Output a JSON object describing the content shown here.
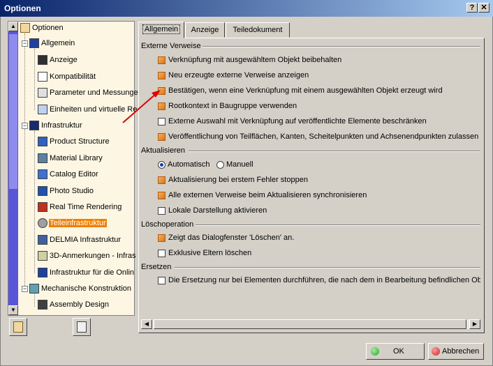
{
  "window": {
    "title": "Optionen",
    "help_label": "?",
    "close_label": "✕"
  },
  "tree": [
    {
      "label": "Optionen",
      "icon": "options-root-icon"
    },
    {
      "label": "Allgemein",
      "icon": "general-icon"
    },
    {
      "label": "Anzeige",
      "icon": "display-icon"
    },
    {
      "label": "Kompatibilität",
      "icon": "compatibility-icon"
    },
    {
      "label": "Parameter und Messungen",
      "icon": "parameters-icon"
    },
    {
      "label": "Einheiten und virtuelle Re",
      "icon": "units-icon"
    },
    {
      "label": "Infrastruktur",
      "icon": "infrastructure-icon"
    },
    {
      "label": "Product Structure",
      "icon": "product-structure-icon"
    },
    {
      "label": "Material Library",
      "icon": "material-library-icon"
    },
    {
      "label": "Catalog Editor",
      "icon": "catalog-editor-icon"
    },
    {
      "label": "Photo Studio",
      "icon": "photo-studio-icon"
    },
    {
      "label": "Real Time Rendering",
      "icon": "real-time-rendering-icon"
    },
    {
      "label": "Teileinfrastruktur",
      "icon": "part-infrastructure-icon"
    },
    {
      "label": "DELMIA Infrastruktur",
      "icon": "delmia-icon"
    },
    {
      "label": "3D-Anmerkungen - Infras",
      "icon": "annotations-icon"
    },
    {
      "label": "Infrastruktur für die Onlin",
      "icon": "online-infrastructure-icon"
    },
    {
      "label": "Mechanische Konstruktion",
      "icon": "mechanical-design-icon"
    },
    {
      "label": "Assembly Design",
      "icon": "assembly-design-icon"
    }
  ],
  "tabs": [
    {
      "label": "Allgemein"
    },
    {
      "label": "Anzeige"
    },
    {
      "label": "Teiledokument"
    }
  ],
  "sections": {
    "externe_verweise": {
      "title": "Externe Verweise",
      "options": [
        {
          "label": "Verknüpfung mit ausgewähltem Objekt beibehalten",
          "checked": true
        },
        {
          "label": "Neu erzeugte externe Verweise anzeigen",
          "checked": true
        },
        {
          "label": "Bestätigen, wenn eine Verknüpfung mit einem ausgewählten Objekt erzeugt wird",
          "checked": true
        },
        {
          "label": "Rootkontext in Baugruppe verwenden",
          "checked": true
        },
        {
          "label": "Externe Auswahl mit Verknüpfung auf veröffentlichte Elemente beschränken",
          "checked": false
        },
        {
          "label": "Veröffentlichung von Teilflächen, Kanten, Scheitelpunkten und Achsenendpunkten zulassen",
          "checked": true
        }
      ]
    },
    "aktualisieren": {
      "title": "Aktualisieren",
      "radio": [
        {
          "label": "Automatisch",
          "selected": true
        },
        {
          "label": "Manuell",
          "selected": false
        }
      ],
      "options": [
        {
          "label": "Aktualisierung bei erstem Fehler stoppen",
          "checked": true
        },
        {
          "label": "Alle externen Verweise beim Aktualisieren synchronisieren",
          "checked": true
        },
        {
          "label": "Lokale Darstellung aktivieren",
          "checked": false
        }
      ]
    },
    "loeschoperation": {
      "title": "Löschoperation",
      "options": [
        {
          "label": "Zeigt das Dialogfenster 'Löschen' an.",
          "checked": true
        },
        {
          "label": "Exklusive Eltern löschen",
          "checked": false
        }
      ]
    },
    "ersetzen": {
      "title": "Ersetzen",
      "options": [
        {
          "label": "Die Ersetzung nur bei Elementen durchführen, die nach dem in Bearbeitung befindlichen Objekt",
          "checked": false
        }
      ]
    }
  },
  "buttons": {
    "ok": "OK",
    "cancel": "Abbrechen"
  },
  "colors": {
    "checked_box": "#e8892a",
    "selected_tree_item": "#f08000",
    "ok_indicator": "#2ea02e",
    "cancel_indicator": "#d02020",
    "annotation_arrow": "#e00000"
  }
}
